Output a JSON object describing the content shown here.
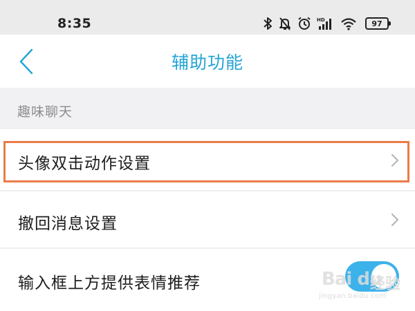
{
  "status_bar": {
    "time": "8:35",
    "icons": [
      "bluetooth-icon",
      "mute-bell-icon",
      "alarm-icon",
      "hd-signal-icon",
      "wifi-icon"
    ],
    "network_tag": "HD",
    "battery": "97"
  },
  "header": {
    "title": "辅助功能",
    "back_icon": "chevron-left-icon",
    "accent_color": "#24a4d6"
  },
  "section": {
    "title": "趣味聊天"
  },
  "settings": [
    {
      "label": "头像双击动作设置",
      "control": "chevron-right-icon",
      "highlighted": true
    },
    {
      "label": "撤回消息设置",
      "control": "chevron-right-icon"
    },
    {
      "label": "输入框上方提供表情推荐",
      "control": "toggle",
      "toggle_on": true
    }
  ],
  "colors": {
    "highlight": "#ec7a45",
    "toggle_on": "#3cb2ea",
    "section_bg": "#f1f1f4"
  },
  "watermark": {
    "logo": "Bai  du",
    "brand": "经验",
    "url": "jingyan.baidu.com"
  }
}
